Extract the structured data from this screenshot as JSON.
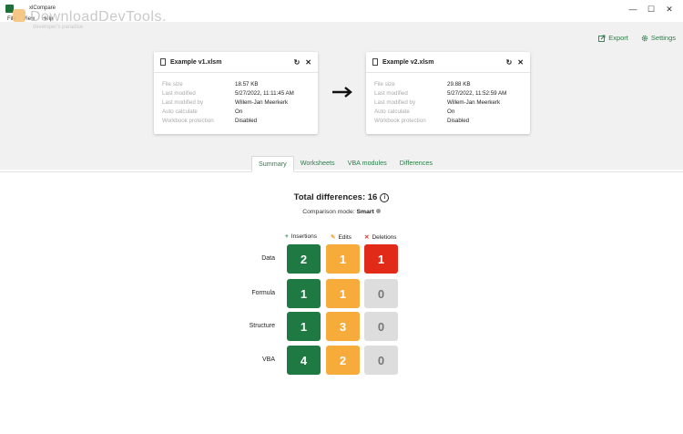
{
  "window": {
    "title": "xlCompare",
    "menu": [
      "File",
      "View",
      "Help"
    ],
    "minimize": "—",
    "maximize": "☐",
    "close": "✕"
  },
  "watermark": {
    "text": "DownloadDevTools.",
    "subtext": "developer's paradise"
  },
  "toolbar": {
    "export_label": "Export",
    "settings_label": "Settings"
  },
  "left_file": {
    "name": "Example v1.xlsm",
    "meta": [
      {
        "key": "File size",
        "value": "18.57 KB"
      },
      {
        "key": "Last modified",
        "value": "5/27/2022, 11:11:45 AM"
      },
      {
        "key": "Last modified by",
        "value": "Willem-Jan Meerkerk"
      },
      {
        "key": "Auto calculate",
        "value": "On"
      },
      {
        "key": "Workbook protection",
        "value": "Disabled"
      }
    ]
  },
  "right_file": {
    "name": "Example v2.xlsm",
    "meta": [
      {
        "key": "File size",
        "value": "29.88 KB"
      },
      {
        "key": "Last modified",
        "value": "5/27/2022, 11:52:59 AM"
      },
      {
        "key": "Last modified by",
        "value": "Willem-Jan Meerkerk"
      },
      {
        "key": "Auto calculate",
        "value": "On"
      },
      {
        "key": "Workbook protection",
        "value": "Disabled"
      }
    ]
  },
  "tabs": [
    "Summary",
    "Worksheets",
    "VBA modules",
    "Differences"
  ],
  "summary": {
    "total_label": "Total differences: 16",
    "mode_prefix": "Comparison mode: ",
    "mode_value": "Smart",
    "legend": {
      "insertions": "Insertions",
      "edits": "Edits",
      "deletions": "Deletions"
    },
    "rows": [
      {
        "label": "Data",
        "insertions": "2",
        "edits": "1",
        "deletions": "1"
      },
      {
        "label": "Formula",
        "insertions": "1",
        "edits": "1",
        "deletions": "0"
      },
      {
        "label": "Structure",
        "insertions": "1",
        "edits": "3",
        "deletions": "0"
      },
      {
        "label": "VBA",
        "insertions": "4",
        "edits": "2",
        "deletions": "0"
      }
    ]
  },
  "colors": {
    "accent": "#2e7d4a",
    "insertion": "#1e7a42",
    "edit": "#f6ab3a",
    "deletion": "#e12a17",
    "zero": "#dddddd"
  }
}
